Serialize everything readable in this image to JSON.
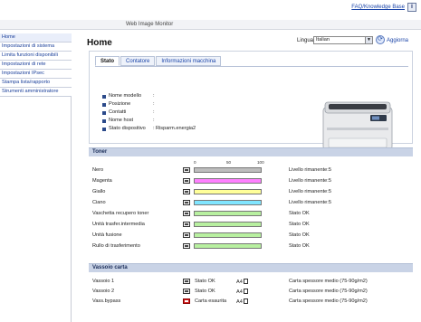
{
  "header": {
    "title": "Web Image Monitor",
    "faq_link": "FAQ/Knowledge Base",
    "help_label": "i"
  },
  "sidebar": {
    "items": [
      {
        "label": "Home",
        "active": true
      },
      {
        "label": "Impostazioni di sistema"
      },
      {
        "label": "Limita funzioni disponibili"
      },
      {
        "label": "Impostazioni di rete"
      },
      {
        "label": "Impostazioni IPsec"
      },
      {
        "label": "Stampa lista/rapporto"
      },
      {
        "label": "Strumenti amministratore"
      }
    ]
  },
  "page": {
    "title": "Home",
    "language_label": "Lingua",
    "language_value": "Italian",
    "refresh_label": "Aggiorna"
  },
  "tabs": [
    {
      "label": "Stato",
      "active": true
    },
    {
      "label": "Contatore"
    },
    {
      "label": "Informazioni macchina"
    }
  ],
  "device_info": [
    {
      "label": "Nome modello",
      "value": ""
    },
    {
      "label": "Posizione",
      "value": ""
    },
    {
      "label": "Contatti",
      "value": ""
    },
    {
      "label": "Nome host",
      "value": ""
    },
    {
      "label": "Stato dispositivo",
      "value": "Risparm.energia2"
    }
  ],
  "toner": {
    "title": "Toner",
    "scale": [
      "0",
      "50",
      "100"
    ],
    "rows": [
      {
        "name": "Nero",
        "color": "#bdbdbd",
        "fill": 100,
        "status": "Livello rimanente:5"
      },
      {
        "name": "Magenta",
        "color": "#ff80ff",
        "fill": 100,
        "status": "Livello rimanente:5"
      },
      {
        "name": "Giallo",
        "color": "#ffff99",
        "fill": 100,
        "status": "Livello rimanente:5"
      },
      {
        "name": "Ciano",
        "color": "#80e5ff",
        "fill": 100,
        "status": "Livello rimanente:5"
      },
      {
        "name": "Vaschetta recupero toner",
        "color": "#b8f0a0",
        "fill": 100,
        "status": "Stato OK"
      },
      {
        "name": "Unità trasfer.intermedia",
        "color": "#b8f0a0",
        "fill": 100,
        "status": "Stato OK"
      },
      {
        "name": "Unità fusione",
        "color": "#b8f0a0",
        "fill": 100,
        "status": "Stato OK"
      },
      {
        "name": "Rullo di trasferimento",
        "color": "#b8f0a0",
        "fill": 100,
        "status": "Stato OK"
      }
    ]
  },
  "trays": {
    "title": "Vassoio carta",
    "rows": [
      {
        "name": "Vassoio 1",
        "status": "Stato OK",
        "size": "A4",
        "type": "Carta spessore medio (75-90g/m2)",
        "alert": false
      },
      {
        "name": "Vassoio 2",
        "status": "Stato OK",
        "size": "A4",
        "type": "Carta spessore medio (75-90g/m2)",
        "alert": false
      },
      {
        "name": "Vass.bypass",
        "status": "Carta esaurita",
        "size": "A4",
        "type": "Carta spessore medio (75-90g/m2)",
        "alert": true
      }
    ]
  },
  "colors": {
    "accent": "#1a44a8",
    "section_header": "#c9d3e6",
    "ok_bar": "#b8f0a0"
  }
}
